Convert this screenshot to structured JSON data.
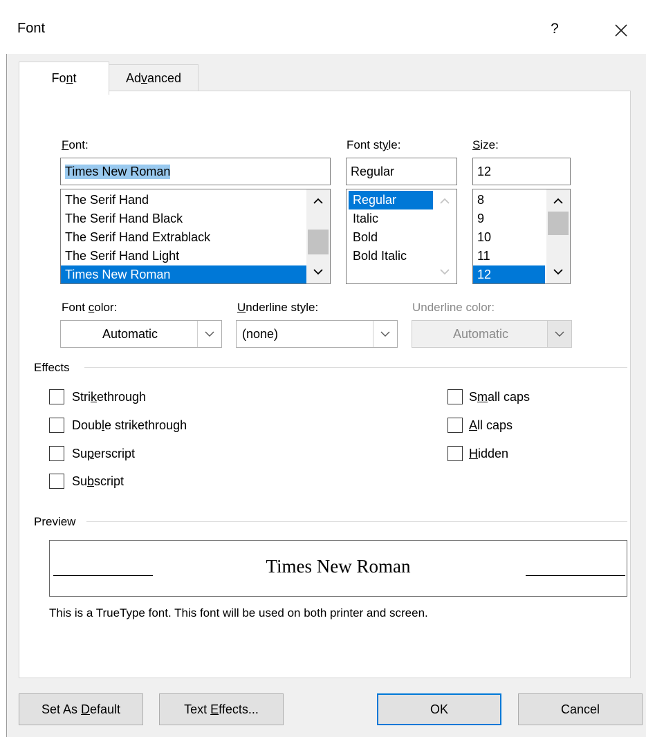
{
  "window": {
    "title": "Font"
  },
  "titlebar": {
    "help_label": "?"
  },
  "tabs": [
    {
      "pre": "Fo",
      "key": "n",
      "post": "t"
    },
    {
      "pre": "Ad",
      "key": "v",
      "post": "anced"
    }
  ],
  "font_field": {
    "label_key": "F",
    "label_rest": "ont:",
    "value": "Times New Roman",
    "list": [
      "The Serif Hand",
      "The Serif Hand Black",
      "The Serif Hand Extrablack",
      "The Serif Hand Light",
      "Times New Roman"
    ]
  },
  "style_field": {
    "label_pre": "Font st",
    "label_key": "y",
    "label_post": "le:",
    "value": "Regular",
    "list": [
      "Regular",
      "Italic",
      "Bold",
      "Bold Italic"
    ]
  },
  "size_field": {
    "label_key": "S",
    "label_rest": "ize:",
    "value": "12",
    "list": [
      "8",
      "9",
      "10",
      "11",
      "12"
    ]
  },
  "font_color": {
    "label_pre": "Font ",
    "label_key": "c",
    "label_post": "olor:",
    "value": "Automatic"
  },
  "underline_style": {
    "label_key": "U",
    "label_rest": "nderline style:",
    "value": "(none)"
  },
  "underline_color": {
    "label": "Underline color:",
    "value": "Automatic"
  },
  "effects": {
    "header": "Effects",
    "left": [
      {
        "pre": "Stri",
        "key": "k",
        "post": "ethrough"
      },
      {
        "pre": "Doub",
        "key": "l",
        "post": "e strikethrough"
      },
      {
        "pre": "Su",
        "key": "p",
        "post": "erscript"
      },
      {
        "pre": "Su",
        "key": "b",
        "post": "script"
      }
    ],
    "right": [
      {
        "pre": "S",
        "key": "m",
        "post": "all caps"
      },
      {
        "pre": "",
        "key": "A",
        "post": "ll caps"
      },
      {
        "pre": "",
        "key": "H",
        "post": "idden"
      }
    ]
  },
  "preview": {
    "header": "Preview",
    "sample": "Times New Roman",
    "description": "This is a TrueType font. This font will be used on both printer and screen."
  },
  "buttons": {
    "set_default": {
      "pre": "Set As ",
      "key": "D",
      "post": "efault"
    },
    "text_effects": {
      "pre": "Text ",
      "key": "E",
      "post": "ffects..."
    },
    "ok": "OK",
    "cancel": "Cancel"
  }
}
